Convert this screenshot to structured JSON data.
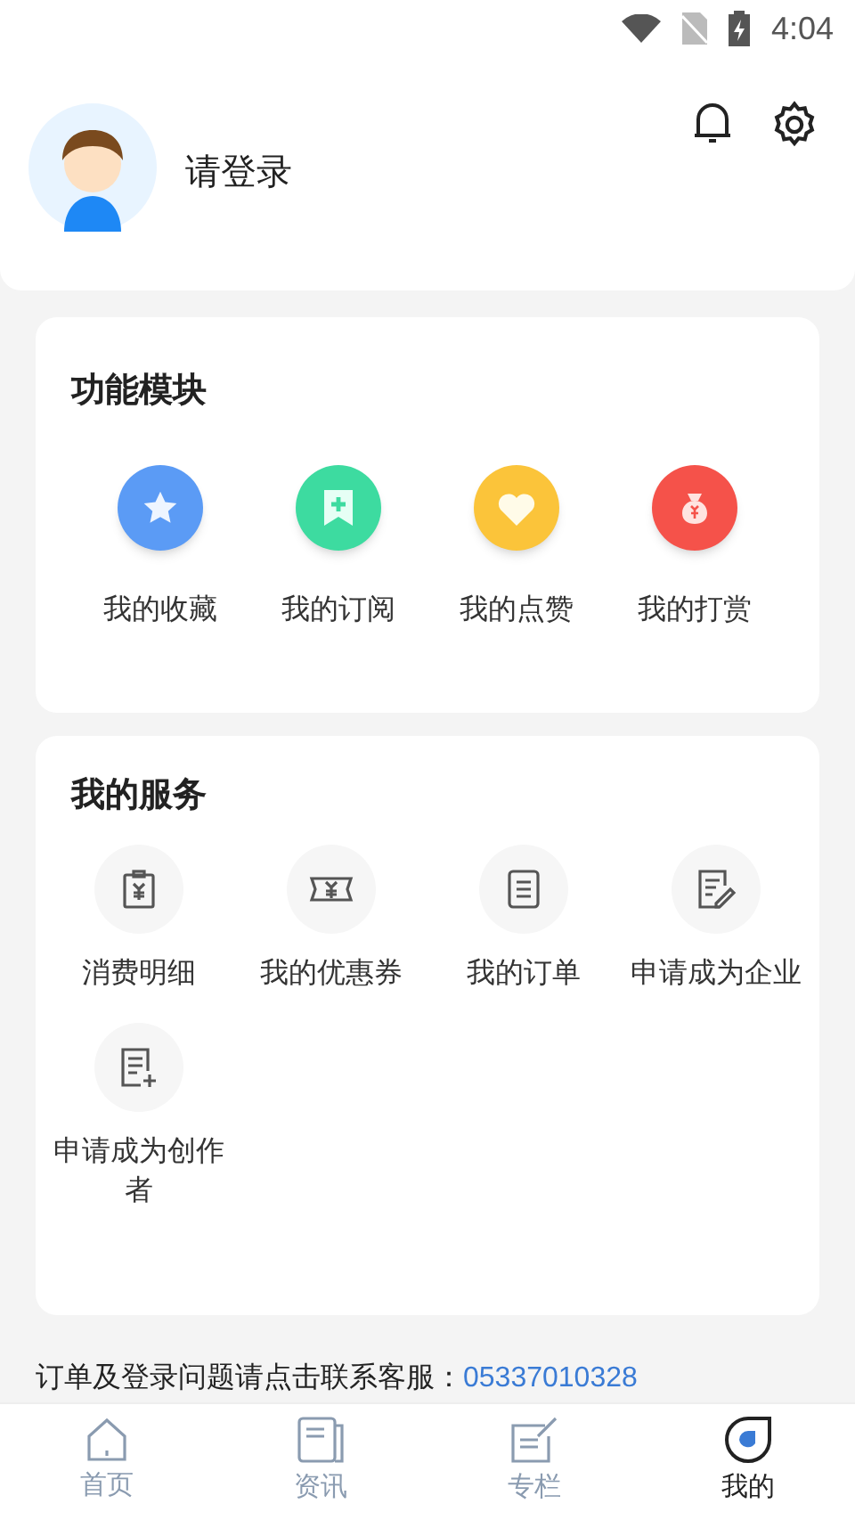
{
  "status_bar": {
    "time": "4:04"
  },
  "header": {
    "login_prompt": "请登录"
  },
  "features": {
    "title": "功能模块",
    "items": [
      {
        "label": "我的收藏",
        "kind": "star",
        "color": "#5b9bf5"
      },
      {
        "label": "我的订阅",
        "kind": "bookmark",
        "color": "#3ddba0"
      },
      {
        "label": "我的点赞",
        "kind": "heart",
        "color": "#fbc43a"
      },
      {
        "label": "我的打赏",
        "kind": "moneybag",
        "color": "#f5524a"
      }
    ]
  },
  "services": {
    "title": "我的服务",
    "items": [
      {
        "label": "消费明细",
        "kind": "receipt"
      },
      {
        "label": "我的优惠券",
        "kind": "coupon"
      },
      {
        "label": "我的订单",
        "kind": "document"
      },
      {
        "label": "申请成为企业",
        "kind": "edit"
      },
      {
        "label": "申请成为创作者",
        "kind": "add-document"
      }
    ]
  },
  "contact": {
    "text": "订单及登录问题请点击联系客服：",
    "phone": "05337010328"
  },
  "tab_bar": [
    {
      "label": "首页",
      "kind": "home",
      "selected": false
    },
    {
      "label": "资讯",
      "kind": "news",
      "selected": false
    },
    {
      "label": "专栏",
      "kind": "column",
      "selected": false
    },
    {
      "label": "我的",
      "kind": "me",
      "selected": true
    }
  ]
}
